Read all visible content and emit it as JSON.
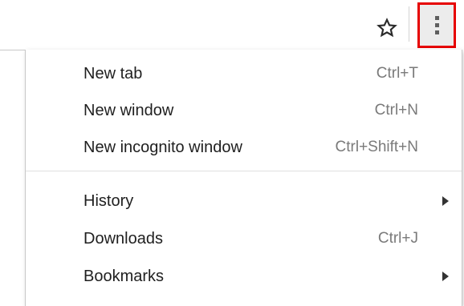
{
  "toolbar": {
    "bookmark_icon": "star-icon",
    "menu_icon": "more-vertical-icon",
    "highlight_color": "#e60000"
  },
  "menu": {
    "items": [
      {
        "label": "New tab",
        "shortcut": "Ctrl+T"
      },
      {
        "label": "New window",
        "shortcut": "Ctrl+N"
      },
      {
        "label": "New incognito window",
        "shortcut": "Ctrl+Shift+N"
      },
      {
        "label": "History",
        "submenu": true
      },
      {
        "label": "Downloads",
        "shortcut": "Ctrl+J"
      },
      {
        "label": "Bookmarks",
        "submenu": true
      }
    ]
  }
}
